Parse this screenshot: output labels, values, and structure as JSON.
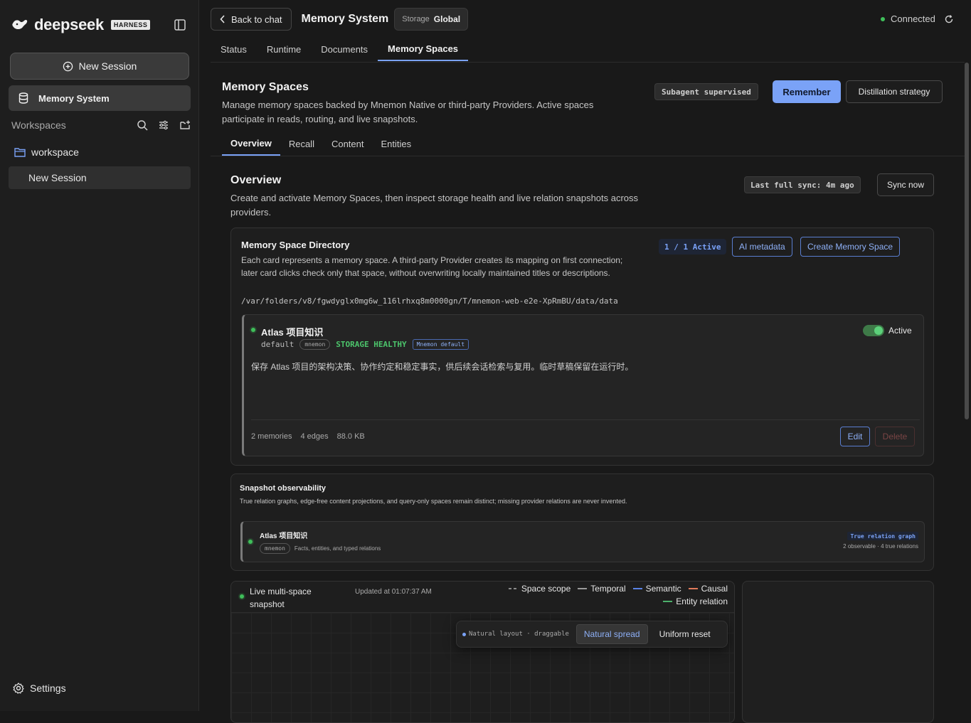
{
  "sidebar": {
    "brand_name": "deepseek",
    "brand_badge": "HARNESS",
    "new_session_label": "New Session",
    "active_item_label": "Memory System",
    "workspaces_label": "Workspaces",
    "workspace_name": "workspace",
    "session_item_label": "New Session",
    "settings_label": "Settings"
  },
  "topbar": {
    "back_label": "Back to chat",
    "title": "Memory System",
    "storage_label": "Storage",
    "storage_value": "Global",
    "connection_status": "Connected"
  },
  "main_tabs": [
    "Status",
    "Runtime",
    "Documents",
    "Memory Spaces"
  ],
  "main_tab_active": "Memory Spaces",
  "section": {
    "title": "Memory Spaces",
    "description": "Manage memory spaces backed by Mnemon Native or third-party Providers. Active spaces participate in reads, routing, and live snapshots.",
    "subagent_chip": "Subagent supervised",
    "remember_label": "Remember",
    "distillation_label": "Distillation strategy"
  },
  "sub_tabs": [
    "Overview",
    "Recall",
    "Content",
    "Entities"
  ],
  "overview": {
    "title": "Overview",
    "description": "Create and activate Memory Spaces, then inspect storage health and live relation snapshots across providers.",
    "last_sync": "Last full sync: 4m ago",
    "sync_label": "Sync now"
  },
  "directory": {
    "title": "Memory Space Directory",
    "description": "Each card represents a memory space. A third-party Provider creates its mapping on first connection; later card clicks check only that space, without overwriting locally maintained titles or descriptions.",
    "path": "/var/folders/v8/fgwdyglx0mg6w_116lrhxq8m0000gn/T/mnemon-web-e2e-XpRmBU/data/data",
    "active_count": "1 / 1 Active",
    "ai_metadata_label": "AI metadata",
    "create_label": "Create Memory Space"
  },
  "space": {
    "name": "Atlas 项目知识",
    "id": "default",
    "provider": "mnemon",
    "health": "STORAGE HEALTHY",
    "default_chip": "Mnemon default",
    "description": "保存 Atlas 项目的架构决策、协作约定和稳定事实，供后续会话检索与复用。临时草稿保留在运行时。",
    "active_label": "Active",
    "active": true,
    "memories": "2 memories",
    "edges": "4 edges",
    "size": "88.0 KB",
    "edit_label": "Edit",
    "delete_label": "Delete"
  },
  "snapshot": {
    "title": "Snapshot observability",
    "description": "True relation graphs, edge-free content projections, and query-only spaces remain distinct; missing provider relations are never invented.",
    "item_name": "Atlas 项目知识",
    "item_provider": "mnemon",
    "item_desc": "Facts, entities, and typed relations",
    "relation_chip": "True relation graph",
    "relation_stats": "2 observable · 4 true relations"
  },
  "live": {
    "title": "Live multi-space snapshot",
    "updated": "Updated at 01:07:37 AM",
    "legend": [
      {
        "label": "Space scope",
        "color": "#8a8a8a",
        "dashed": true
      },
      {
        "label": "Temporal",
        "color": "#9a9a9a",
        "dashed": false
      },
      {
        "label": "Semantic",
        "color": "#5a82e6",
        "dashed": false
      },
      {
        "label": "Causal",
        "color": "#e07a5a",
        "dashed": false
      },
      {
        "label": "Entity relation",
        "color": "#4cb06b",
        "dashed": false
      }
    ],
    "layout_label": "Natural layout · draggable",
    "natural_spread_label": "Natural spread",
    "uniform_reset_label": "Uniform reset"
  },
  "colors": {
    "accent": "#7aa2f7",
    "healthy": "#4cc46b",
    "status_green": "#3fbf5a"
  }
}
